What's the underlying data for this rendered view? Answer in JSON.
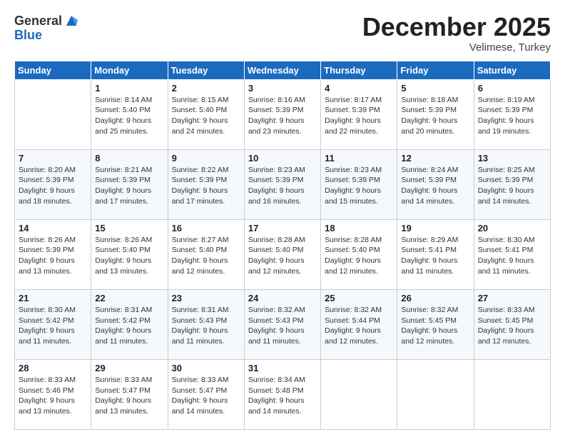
{
  "header": {
    "logo_general": "General",
    "logo_blue": "Blue",
    "month_title": "December 2025",
    "location": "Velimese, Turkey"
  },
  "days_of_week": [
    "Sunday",
    "Monday",
    "Tuesday",
    "Wednesday",
    "Thursday",
    "Friday",
    "Saturday"
  ],
  "weeks": [
    [
      {
        "day": "",
        "sunrise": "",
        "sunset": "",
        "daylight": ""
      },
      {
        "day": "1",
        "sunrise": "Sunrise: 8:14 AM",
        "sunset": "Sunset: 5:40 PM",
        "daylight": "Daylight: 9 hours and 25 minutes."
      },
      {
        "day": "2",
        "sunrise": "Sunrise: 8:15 AM",
        "sunset": "Sunset: 5:40 PM",
        "daylight": "Daylight: 9 hours and 24 minutes."
      },
      {
        "day": "3",
        "sunrise": "Sunrise: 8:16 AM",
        "sunset": "Sunset: 5:39 PM",
        "daylight": "Daylight: 9 hours and 23 minutes."
      },
      {
        "day": "4",
        "sunrise": "Sunrise: 8:17 AM",
        "sunset": "Sunset: 5:39 PM",
        "daylight": "Daylight: 9 hours and 22 minutes."
      },
      {
        "day": "5",
        "sunrise": "Sunrise: 8:18 AM",
        "sunset": "Sunset: 5:39 PM",
        "daylight": "Daylight: 9 hours and 20 minutes."
      },
      {
        "day": "6",
        "sunrise": "Sunrise: 8:19 AM",
        "sunset": "Sunset: 5:39 PM",
        "daylight": "Daylight: 9 hours and 19 minutes."
      }
    ],
    [
      {
        "day": "7",
        "sunrise": "Sunrise: 8:20 AM",
        "sunset": "Sunset: 5:39 PM",
        "daylight": "Daylight: 9 hours and 18 minutes."
      },
      {
        "day": "8",
        "sunrise": "Sunrise: 8:21 AM",
        "sunset": "Sunset: 5:39 PM",
        "daylight": "Daylight: 9 hours and 17 minutes."
      },
      {
        "day": "9",
        "sunrise": "Sunrise: 8:22 AM",
        "sunset": "Sunset: 5:39 PM",
        "daylight": "Daylight: 9 hours and 17 minutes."
      },
      {
        "day": "10",
        "sunrise": "Sunrise: 8:23 AM",
        "sunset": "Sunset: 5:39 PM",
        "daylight": "Daylight: 9 hours and 16 minutes."
      },
      {
        "day": "11",
        "sunrise": "Sunrise: 8:23 AM",
        "sunset": "Sunset: 5:39 PM",
        "daylight": "Daylight: 9 hours and 15 minutes."
      },
      {
        "day": "12",
        "sunrise": "Sunrise: 8:24 AM",
        "sunset": "Sunset: 5:39 PM",
        "daylight": "Daylight: 9 hours and 14 minutes."
      },
      {
        "day": "13",
        "sunrise": "Sunrise: 8:25 AM",
        "sunset": "Sunset: 5:39 PM",
        "daylight": "Daylight: 9 hours and 14 minutes."
      }
    ],
    [
      {
        "day": "14",
        "sunrise": "Sunrise: 8:26 AM",
        "sunset": "Sunset: 5:39 PM",
        "daylight": "Daylight: 9 hours and 13 minutes."
      },
      {
        "day": "15",
        "sunrise": "Sunrise: 8:26 AM",
        "sunset": "Sunset: 5:40 PM",
        "daylight": "Daylight: 9 hours and 13 minutes."
      },
      {
        "day": "16",
        "sunrise": "Sunrise: 8:27 AM",
        "sunset": "Sunset: 5:40 PM",
        "daylight": "Daylight: 9 hours and 12 minutes."
      },
      {
        "day": "17",
        "sunrise": "Sunrise: 8:28 AM",
        "sunset": "Sunset: 5:40 PM",
        "daylight": "Daylight: 9 hours and 12 minutes."
      },
      {
        "day": "18",
        "sunrise": "Sunrise: 8:28 AM",
        "sunset": "Sunset: 5:40 PM",
        "daylight": "Daylight: 9 hours and 12 minutes."
      },
      {
        "day": "19",
        "sunrise": "Sunrise: 8:29 AM",
        "sunset": "Sunset: 5:41 PM",
        "daylight": "Daylight: 9 hours and 11 minutes."
      },
      {
        "day": "20",
        "sunrise": "Sunrise: 8:30 AM",
        "sunset": "Sunset: 5:41 PM",
        "daylight": "Daylight: 9 hours and 11 minutes."
      }
    ],
    [
      {
        "day": "21",
        "sunrise": "Sunrise: 8:30 AM",
        "sunset": "Sunset: 5:42 PM",
        "daylight": "Daylight: 9 hours and 11 minutes."
      },
      {
        "day": "22",
        "sunrise": "Sunrise: 8:31 AM",
        "sunset": "Sunset: 5:42 PM",
        "daylight": "Daylight: 9 hours and 11 minutes."
      },
      {
        "day": "23",
        "sunrise": "Sunrise: 8:31 AM",
        "sunset": "Sunset: 5:43 PM",
        "daylight": "Daylight: 9 hours and 11 minutes."
      },
      {
        "day": "24",
        "sunrise": "Sunrise: 8:32 AM",
        "sunset": "Sunset: 5:43 PM",
        "daylight": "Daylight: 9 hours and 11 minutes."
      },
      {
        "day": "25",
        "sunrise": "Sunrise: 8:32 AM",
        "sunset": "Sunset: 5:44 PM",
        "daylight": "Daylight: 9 hours and 12 minutes."
      },
      {
        "day": "26",
        "sunrise": "Sunrise: 8:32 AM",
        "sunset": "Sunset: 5:45 PM",
        "daylight": "Daylight: 9 hours and 12 minutes."
      },
      {
        "day": "27",
        "sunrise": "Sunrise: 8:33 AM",
        "sunset": "Sunset: 5:45 PM",
        "daylight": "Daylight: 9 hours and 12 minutes."
      }
    ],
    [
      {
        "day": "28",
        "sunrise": "Sunrise: 8:33 AM",
        "sunset": "Sunset: 5:46 PM",
        "daylight": "Daylight: 9 hours and 13 minutes."
      },
      {
        "day": "29",
        "sunrise": "Sunrise: 8:33 AM",
        "sunset": "Sunset: 5:47 PM",
        "daylight": "Daylight: 9 hours and 13 minutes."
      },
      {
        "day": "30",
        "sunrise": "Sunrise: 8:33 AM",
        "sunset": "Sunset: 5:47 PM",
        "daylight": "Daylight: 9 hours and 14 minutes."
      },
      {
        "day": "31",
        "sunrise": "Sunrise: 8:34 AM",
        "sunset": "Sunset: 5:48 PM",
        "daylight": "Daylight: 9 hours and 14 minutes."
      },
      {
        "day": "",
        "sunrise": "",
        "sunset": "",
        "daylight": ""
      },
      {
        "day": "",
        "sunrise": "",
        "sunset": "",
        "daylight": ""
      },
      {
        "day": "",
        "sunrise": "",
        "sunset": "",
        "daylight": ""
      }
    ]
  ]
}
